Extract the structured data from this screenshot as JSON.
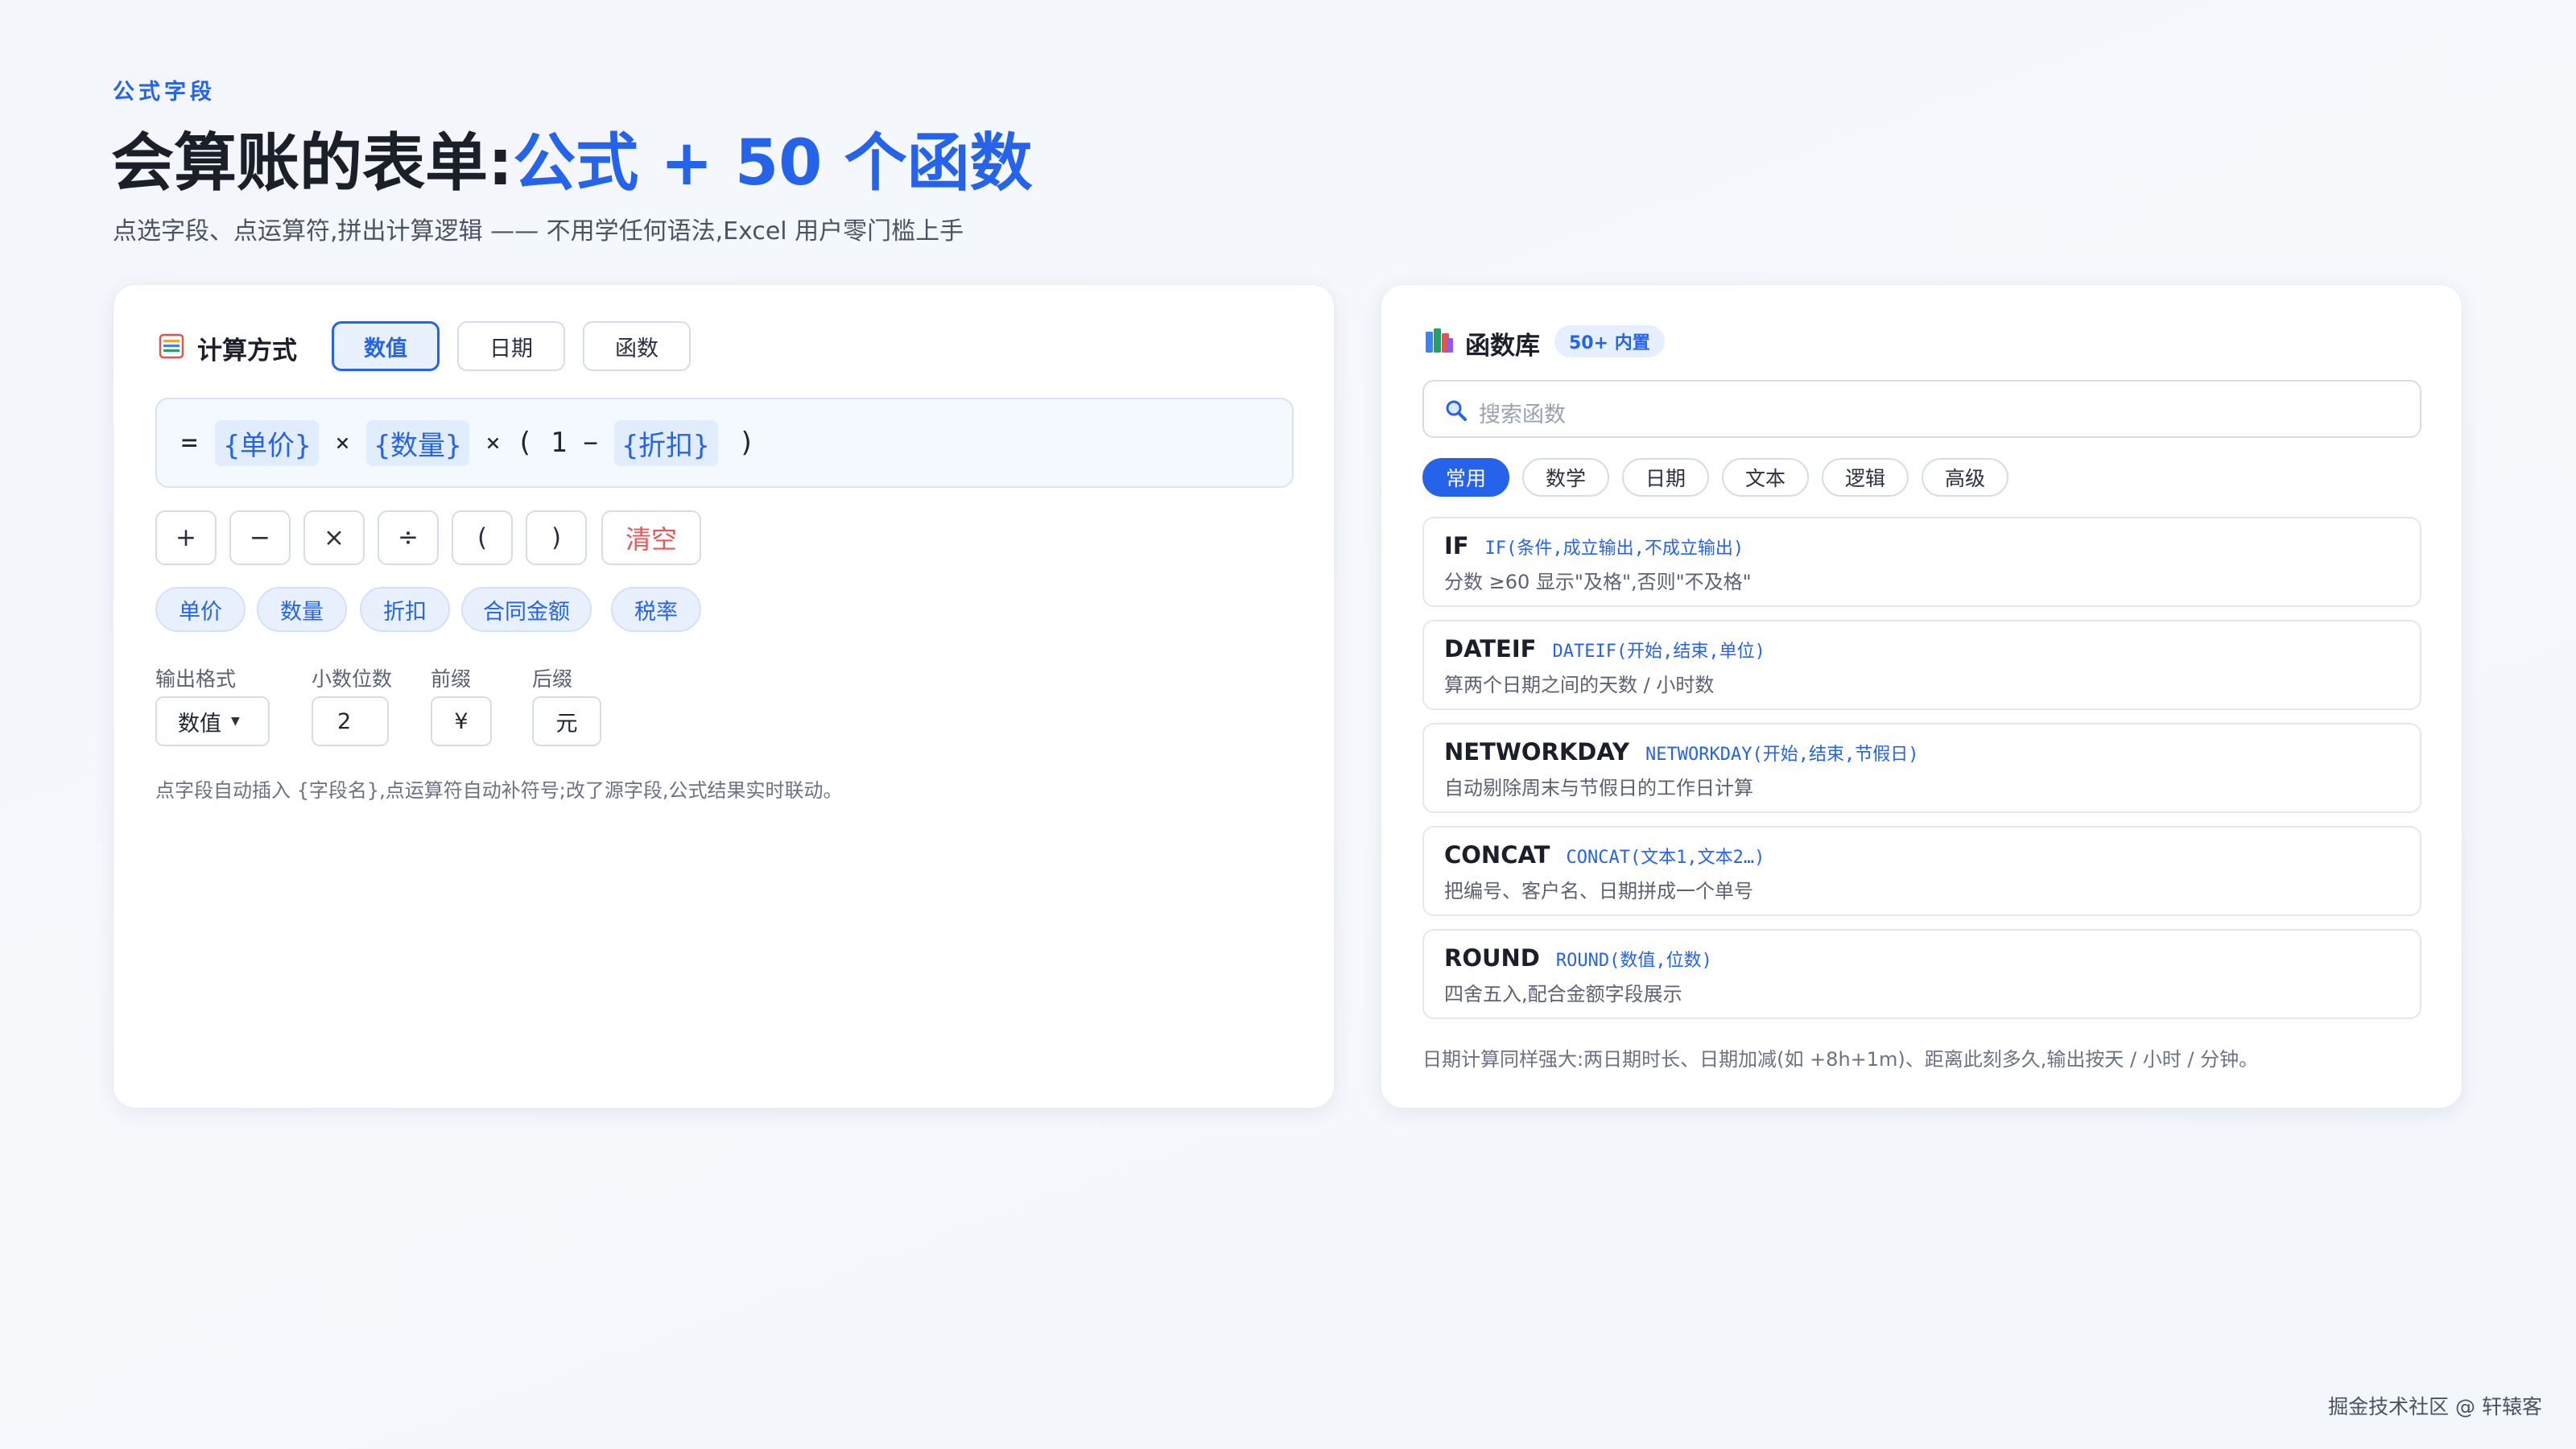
{
  "header": {
    "eyebrow": "公式字段",
    "title_prefix": "会算账的表单:",
    "title_accent": "公式 + 50 个函数",
    "subtitle": "点选字段、点运算符,拼出计算逻辑 —— 不用学任何语法,Excel 用户零门槛上手"
  },
  "left_panel": {
    "icon": "table-icon",
    "title": "计算方式",
    "mode_tabs": [
      {
        "label": "数值",
        "active": true
      },
      {
        "label": "日期",
        "active": false
      },
      {
        "label": "函数",
        "active": false
      }
    ],
    "formula": {
      "eq": "=",
      "t1": "{单价}",
      "op1": "×",
      "t2": "{数量}",
      "op2": "×",
      "lp": "(",
      "one": "1",
      "minus": "−",
      "t3": "{折扣}",
      "rp": ")"
    },
    "operators": [
      "+",
      "−",
      "×",
      "÷",
      "(",
      ")"
    ],
    "clear_label": "清空",
    "fields": [
      "单价",
      "数量",
      "折扣",
      "合同金额",
      "税率"
    ],
    "output": {
      "format_label": "输出格式",
      "format_value": "数值",
      "decimals_label": "小数位数",
      "decimals_value": "2",
      "prefix_label": "前缀",
      "prefix_value": "¥",
      "suffix_label": "后缀",
      "suffix_value": "元"
    },
    "note": "点字段自动插入 {字段名},点运算符自动补符号;改了源字段,公式结果实时联动。"
  },
  "right_panel": {
    "icon": "books-icon",
    "title": "函数库",
    "badge": "50+ 内置",
    "search_placeholder": "搜索函数",
    "categories": [
      {
        "label": "常用",
        "active": true
      },
      {
        "label": "数学",
        "active": false
      },
      {
        "label": "日期",
        "active": false
      },
      {
        "label": "文本",
        "active": false
      },
      {
        "label": "逻辑",
        "active": false
      },
      {
        "label": "高级",
        "active": false
      }
    ],
    "functions": [
      {
        "name": "IF",
        "signature": "IF(条件,成立输出,不成立输出)",
        "description": "分数 ≥60 显示\"及格\",否则\"不及格\""
      },
      {
        "name": "DATEIF",
        "signature": "DATEIF(开始,结束,单位)",
        "description": "算两个日期之间的天数 / 小时数"
      },
      {
        "name": "NETWORKDAY",
        "signature": "NETWORKDAY(开始,结束,节假日)",
        "description": "自动剔除周末与节假日的工作日计算"
      },
      {
        "name": "CONCAT",
        "signature": "CONCAT(文本1,文本2…)",
        "description": "把编号、客户名、日期拼成一个单号"
      },
      {
        "name": "ROUND",
        "signature": "ROUND(数值,位数)",
        "description": "四舍五入,配合金额字段展示"
      }
    ],
    "note": "日期计算同样强大:两日期时长、日期加减(如 +8h+1m)、距离此刻多久,输出按天 / 小时 / 分钟。"
  },
  "footer": {
    "credit": "掘金技术社区 @ 轩辕客"
  },
  "colors": {
    "accent": "#2563eb",
    "danger": "#e05a5a",
    "background": "#f4f7fb"
  }
}
